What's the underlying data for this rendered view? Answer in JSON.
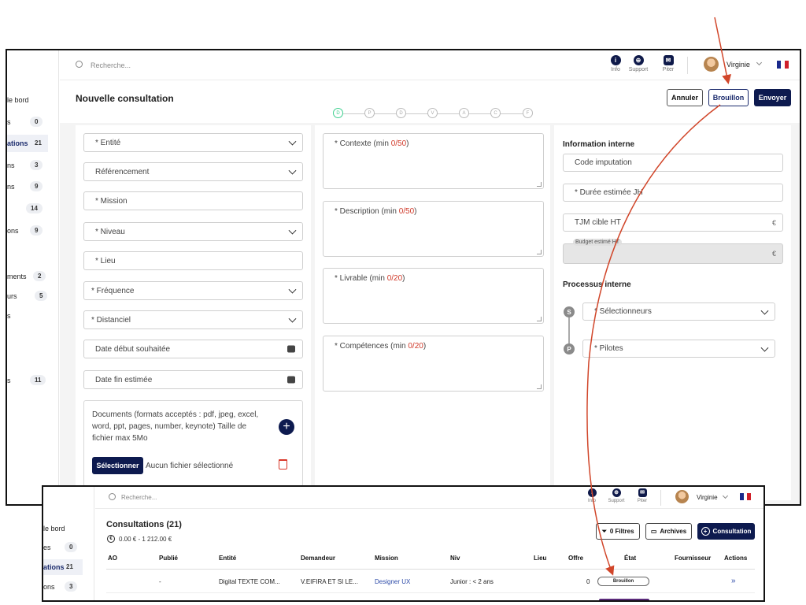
{
  "colors": {
    "accent": "#0d1a4f",
    "arrow": "#d1462a",
    "required_count": "#d03a2a",
    "step_active": "#3ccf8e"
  },
  "main": {
    "search_placeholder": "Recherche...",
    "top_icons": [
      {
        "icon": "info-icon",
        "label": "Info"
      },
      {
        "icon": "support-icon",
        "label": "Support"
      },
      {
        "icon": "chat-icon",
        "label": "Piter"
      }
    ],
    "user": "Virginie",
    "sidebar": [
      {
        "label": "le bord",
        "count": ""
      },
      {
        "label": "s",
        "count": "0"
      },
      {
        "label": "ations",
        "count": "21"
      },
      {
        "label": "ns",
        "count": "3"
      },
      {
        "label": "ns",
        "count": "9"
      },
      {
        "label": "",
        "count": "14"
      },
      {
        "label": "ons",
        "count": "9"
      },
      {
        "label": "ments",
        "count": "2"
      },
      {
        "label": "urs",
        "count": "5"
      },
      {
        "label": "s",
        "count": ""
      },
      {
        "label": "s",
        "count": "11"
      }
    ],
    "page_title": "Nouvelle consultation",
    "steps": [
      "D",
      "P",
      "D",
      "V",
      "A",
      "C",
      "F"
    ],
    "buttons": {
      "cancel": "Annuler",
      "draft": "Brouillon",
      "send": "Envoyer"
    },
    "left_fields": [
      {
        "label": "* Entité",
        "kind": "select"
      },
      {
        "label": "Référencement",
        "kind": "select"
      },
      {
        "label": "* Mission",
        "kind": "text"
      },
      {
        "label": "* Niveau",
        "kind": "select"
      },
      {
        "label": "* Lieu",
        "kind": "text"
      },
      {
        "label": "* Fréquence",
        "kind": "select"
      },
      {
        "label": "* Distanciel",
        "kind": "select"
      },
      {
        "label": "Date début souhaitée",
        "kind": "date"
      },
      {
        "label": "Date fin estimée",
        "kind": "date"
      }
    ],
    "documents": {
      "text": "Documents (formats acceptés : pdf, jpeg, excel, word, ppt, pages, number, keynote) Taille de fichier max 5Mo",
      "select_button": "Sélectionner",
      "no_file": "Aucun fichier sélectionné"
    },
    "textareas": [
      {
        "label": "* Contexte (min ",
        "count": "0/50",
        "suffix": ")"
      },
      {
        "label": "* Description (min ",
        "count": "0/50",
        "suffix": ")"
      },
      {
        "label": "* Livrable (min ",
        "count": "0/20",
        "suffix": ")"
      },
      {
        "label": "* Compétences (min ",
        "count": "0/20",
        "suffix": ")"
      }
    ],
    "internal": {
      "title": "Information interne",
      "code": "Code imputation",
      "duration": "* Durée estimée JH",
      "tjm": "TJM cible HT",
      "budget": "Budget estimé HT",
      "currency": "€"
    },
    "process": {
      "title": "Processus interne",
      "selectors": {
        "badge": "S",
        "label": "* Sélectionneurs"
      },
      "pilots": {
        "badge": "P",
        "label": "* Pilotes"
      }
    }
  },
  "list": {
    "search_placeholder": "Recherche...",
    "top_icons": [
      {
        "icon": "info-icon",
        "label": "Info"
      },
      {
        "icon": "support-icon",
        "label": "Support"
      },
      {
        "icon": "chat-icon",
        "label": "Piter"
      }
    ],
    "user": "Virginie",
    "sidebar": [
      {
        "label": "le bord",
        "count": ""
      },
      {
        "label": "es",
        "count": "0"
      },
      {
        "label": "ations",
        "count": "21"
      },
      {
        "label": "ons",
        "count": "3"
      }
    ],
    "title": "Consultations (21)",
    "amount": "0.00 € - 1 212.00 €",
    "buttons": {
      "filters": "0 Filtres",
      "archives": "Archives",
      "new": "Consultation"
    },
    "columns": [
      "AO",
      "Publié",
      "Entité",
      "Demandeur",
      "Mission",
      "Niv",
      "Lieu",
      "Offre",
      "État",
      "Fournisseur",
      "Actions"
    ],
    "row": {
      "ao": "",
      "published": "-",
      "entity": "Digital TEXTE COM...",
      "requester": "V.EIFIRA ET SI LE...",
      "mission": "Designer UX",
      "level": "Junior : < 2 ans",
      "place": "",
      "offer": "0",
      "state": "Brouillon",
      "supplier": "",
      "action": "»"
    }
  }
}
